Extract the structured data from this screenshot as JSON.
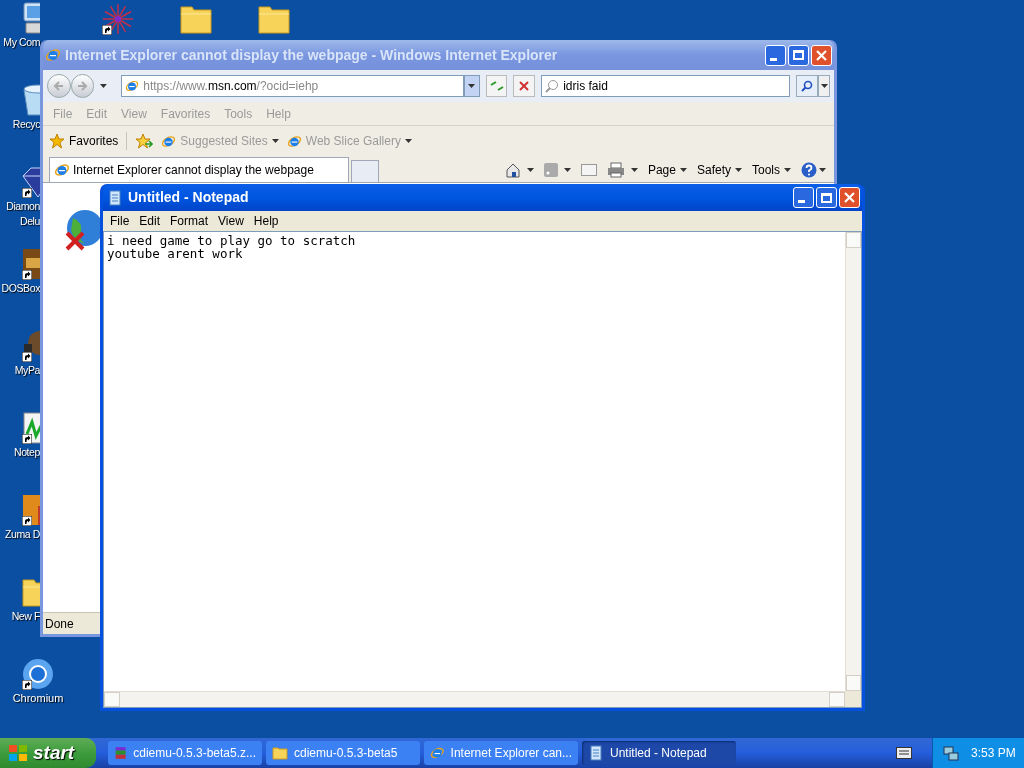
{
  "desktop_icons": [
    {
      "kind": "computer",
      "shortcut": false,
      "label_lines": [
        "My Com"
      ]
    },
    {
      "kind": "recycle",
      "shortcut": false,
      "label_lines": [
        "Recyc"
      ]
    },
    {
      "kind": "diamond",
      "shortcut": true,
      "label_lines": [
        "Diamon",
        "Delu"
      ]
    },
    {
      "kind": "dosbox",
      "shortcut": true,
      "label_lines": [
        "DOSBox"
      ]
    },
    {
      "kind": "paint",
      "shortcut": true,
      "label_lines": [
        "MyPa"
      ]
    },
    {
      "kind": "notepad",
      "shortcut": true,
      "label_lines": [
        "Notep"
      ]
    },
    {
      "kind": "zuma",
      "shortcut": true,
      "label_lines": [
        "Zuma D"
      ]
    },
    {
      "kind": "folder",
      "shortcut": false,
      "label_lines": [
        "New F"
      ]
    },
    {
      "kind": "chromium",
      "shortcut": true,
      "label_lines": [
        "Chromium"
      ]
    }
  ],
  "top_icons": [
    {
      "kind": "fireworks",
      "shortcut": true
    },
    {
      "kind": "folder",
      "shortcut": false
    },
    {
      "kind": "folder",
      "shortcut": false
    }
  ],
  "ie_window": {
    "title": "Internet Explorer cannot display the webpage - Windows Internet Explorer",
    "active": false,
    "address": {
      "before": "https://www.",
      "host": "msn.com",
      "after": "/?ocid=iehp"
    },
    "search": {
      "value": "idris faid"
    },
    "menu": [
      "File",
      "Edit",
      "View",
      "Favorites",
      "Tools",
      "Help"
    ],
    "favorites_label": "Favorites",
    "favorites_links": [
      "Suggested Sites",
      "Web Slice Gallery"
    ],
    "tab": {
      "label": "Internet Explorer cannot display the webpage",
      "selected": true
    },
    "commands": [
      "Page",
      "Safety",
      "Tools"
    ],
    "status": "Done"
  },
  "notepad_window": {
    "title": "Untitled - Notepad",
    "active": true,
    "menu": [
      "File",
      "Edit",
      "Format",
      "View",
      "Help"
    ],
    "lines": [
      "i need game to play go to scratch",
      "youtube arent work"
    ]
  },
  "taskbar": {
    "start": "start",
    "buttons": [
      {
        "kind": "archive",
        "label": "cdiemu-0.5.3-beta5.z...",
        "selected": false
      },
      {
        "kind": "folder",
        "label": "cdiemu-0.5.3-beta5",
        "selected": false
      },
      {
        "kind": "ie",
        "label": "Internet Explorer can...",
        "selected": false
      },
      {
        "kind": "notepad",
        "label": "Untitled - Notepad",
        "selected": true
      }
    ],
    "time": "3:53 PM"
  }
}
